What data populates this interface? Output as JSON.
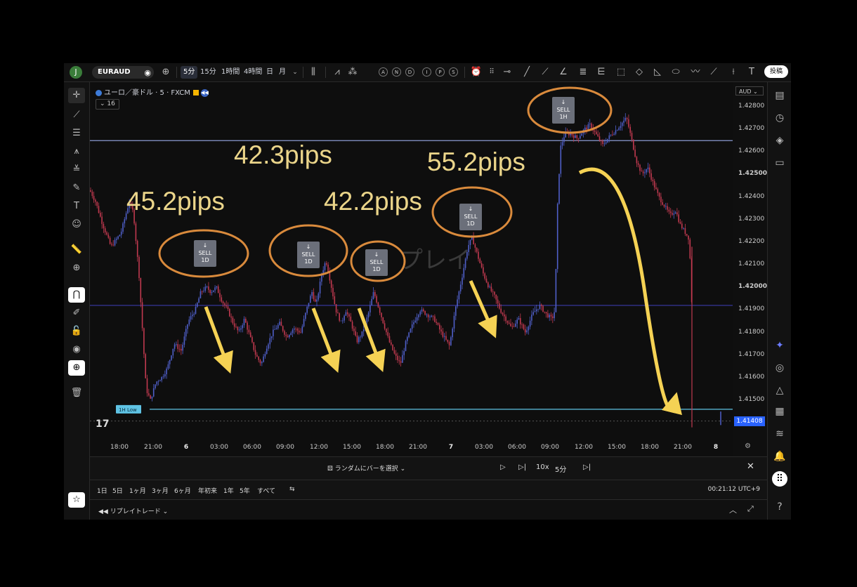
{
  "topbar": {
    "avatar_letter": "J",
    "symbol": "EURAUD",
    "timeframes": [
      "5分",
      "15分",
      "1時間",
      "4時間",
      "日",
      "月"
    ],
    "active_timeframe": "5分",
    "indicator_letters": [
      "A",
      "N",
      "D",
      "I",
      "P",
      "S"
    ],
    "post_label": "投稿"
  },
  "chart_header": {
    "title": "ユーロ／豪ドル · 5 · FXCM",
    "count": "16"
  },
  "watermark": "プレイ",
  "price_axis": {
    "currency": "AUD",
    "labels": [
      "1.42800",
      "1.42700",
      "1.42600",
      "1.42500",
      "1.42400",
      "1.42300",
      "1.42200",
      "1.42100",
      "1.42000",
      "1.41900",
      "1.41800",
      "1.41700",
      "1.41600",
      "1.41500"
    ],
    "last_price": "1.41408"
  },
  "time_axis": {
    "labels": [
      "18:00",
      "21:00",
      "6",
      "03:00",
      "06:00",
      "09:00",
      "12:00",
      "15:00",
      "18:00",
      "21:00",
      "7",
      "03:00",
      "06:00",
      "09:00",
      "12:00",
      "15:00",
      "18:00",
      "21:00",
      "8"
    ]
  },
  "annotations": {
    "pips": [
      "45.2pips",
      "42.3pips",
      "42.2pips",
      "55.2pips"
    ],
    "markers": [
      {
        "arrow": "↓",
        "signal": "SELL",
        "tf": "1D"
      },
      {
        "arrow": "↓",
        "signal": "SELL",
        "tf": "1D"
      },
      {
        "arrow": "↓",
        "signal": "SELL",
        "tf": "1D"
      },
      {
        "arrow": "↓",
        "signal": "SELL",
        "tf": "1D"
      },
      {
        "arrow": "↓",
        "signal": "SELL",
        "tf": "1H"
      }
    ],
    "level_label": "1H Low"
  },
  "replay": {
    "random_label": "ランダムにバーを選択",
    "speed": "10x",
    "interval": "5分"
  },
  "ranges": {
    "items": [
      "1日",
      "5日",
      "1ヶ月",
      "3ヶ月",
      "6ヶ月",
      "年初来",
      "1年",
      "5年",
      "すべて"
    ],
    "clock": "00:21:12 UTC+9"
  },
  "bottom": {
    "panel_label": "リプレイトレード"
  },
  "colors": {
    "accent": "#2962ff",
    "annotation_orange": "#d98a3c",
    "arrow_yellow": "#f5d254",
    "level_line": "#5fc3e4",
    "hline": "#3a3aa8"
  },
  "chart_data": {
    "type": "candlestick",
    "symbol": "EURAUD",
    "timeframe": "5",
    "ylim": [
      1.4135,
      1.4285
    ],
    "horizontal_levels": [
      1.4265,
      1.4192,
      1.4146
    ],
    "last_price": 1.41408,
    "path": [
      [
        0,
        1.4243
      ],
      [
        8,
        1.4238
      ],
      [
        18,
        1.4228
      ],
      [
        30,
        1.4218
      ],
      [
        44,
        1.4224
      ],
      [
        56,
        1.4238
      ],
      [
        62,
        1.4233
      ],
      [
        70,
        1.4205
      ],
      [
        76,
        1.4175
      ],
      [
        80,
        1.4155
      ],
      [
        86,
        1.415
      ],
      [
        94,
        1.4158
      ],
      [
        102,
        1.416
      ],
      [
        110,
        1.4164
      ],
      [
        120,
        1.4175
      ],
      [
        130,
        1.4172
      ],
      [
        140,
        1.4185
      ],
      [
        150,
        1.419
      ],
      [
        158,
        1.4198
      ],
      [
        166,
        1.42
      ],
      [
        172,
        1.4198
      ],
      [
        180,
        1.42
      ],
      [
        188,
        1.4194
      ],
      [
        196,
        1.419
      ],
      [
        204,
        1.4184
      ],
      [
        212,
        1.418
      ],
      [
        220,
        1.4186
      ],
      [
        228,
        1.4178
      ],
      [
        236,
        1.417
      ],
      [
        244,
        1.4166
      ],
      [
        252,
        1.4174
      ],
      [
        260,
        1.418
      ],
      [
        270,
        1.4184
      ],
      [
        280,
        1.4178
      ],
      [
        290,
        1.4182
      ],
      [
        300,
        1.418
      ],
      [
        310,
        1.4192
      ],
      [
        316,
        1.4198
      ],
      [
        322,
        1.4192
      ],
      [
        330,
        1.4206
      ],
      [
        336,
        1.4212
      ],
      [
        342,
        1.4203
      ],
      [
        350,
        1.419
      ],
      [
        358,
        1.4184
      ],
      [
        364,
        1.419
      ],
      [
        372,
        1.4184
      ],
      [
        380,
        1.4176
      ],
      [
        388,
        1.418
      ],
      [
        396,
        1.4188
      ],
      [
        404,
        1.4198
      ],
      [
        410,
        1.4192
      ],
      [
        418,
        1.4184
      ],
      [
        426,
        1.4176
      ],
      [
        434,
        1.417
      ],
      [
        442,
        1.4166
      ],
      [
        450,
        1.4176
      ],
      [
        460,
        1.4184
      ],
      [
        470,
        1.419
      ],
      [
        480,
        1.4188
      ],
      [
        490,
        1.4186
      ],
      [
        500,
        1.418
      ],
      [
        508,
        1.4176
      ],
      [
        512,
        1.4174
      ],
      [
        520,
        1.419
      ],
      [
        530,
        1.4205
      ],
      [
        538,
        1.4218
      ],
      [
        544,
        1.4222
      ],
      [
        552,
        1.4214
      ],
      [
        560,
        1.4206
      ],
      [
        568,
        1.42
      ],
      [
        576,
        1.4196
      ],
      [
        584,
        1.419
      ],
      [
        592,
        1.4186
      ],
      [
        600,
        1.4182
      ],
      [
        610,
        1.4186
      ],
      [
        620,
        1.418
      ],
      [
        630,
        1.4188
      ],
      [
        640,
        1.4192
      ],
      [
        650,
        1.4188
      ],
      [
        658,
        1.4186
      ],
      [
        662,
        1.419
      ],
      [
        666,
        1.424
      ],
      [
        670,
        1.4262
      ],
      [
        676,
        1.4268
      ],
      [
        684,
        1.4268
      ],
      [
        694,
        1.4266
      ],
      [
        704,
        1.427
      ],
      [
        712,
        1.4272
      ],
      [
        720,
        1.4268
      ],
      [
        730,
        1.4263
      ],
      [
        740,
        1.4267
      ],
      [
        750,
        1.427
      ],
      [
        758,
        1.4273
      ],
      [
        764,
        1.4275
      ],
      [
        770,
        1.4267
      ],
      [
        778,
        1.4256
      ],
      [
        786,
        1.425
      ],
      [
        794,
        1.4253
      ],
      [
        802,
        1.4246
      ],
      [
        810,
        1.424
      ],
      [
        818,
        1.4236
      ],
      [
        826,
        1.4232
      ],
      [
        834,
        1.4234
      ],
      [
        840,
        1.4228
      ],
      [
        846,
        1.4225
      ],
      [
        852,
        1.4222
      ],
      [
        855,
        1.421
      ],
      [
        857,
        1.419
      ],
      [
        858,
        1.4141
      ]
    ]
  }
}
